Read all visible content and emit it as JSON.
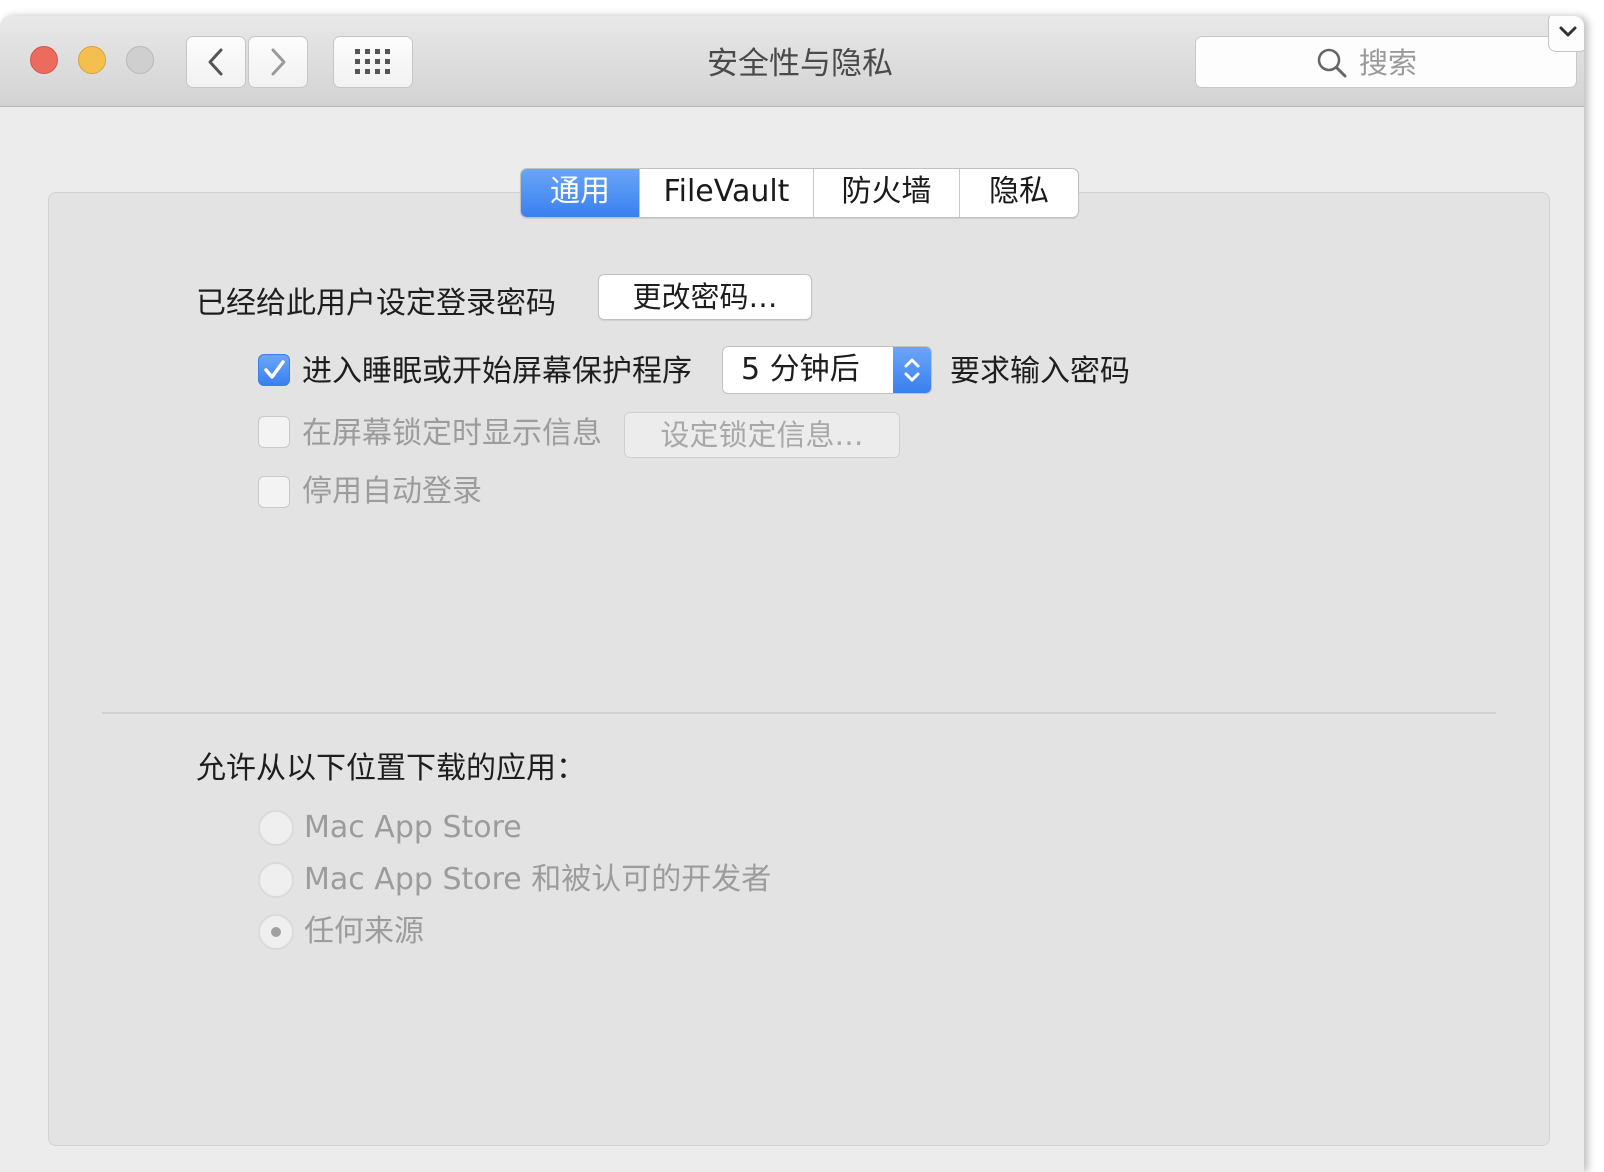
{
  "window": {
    "title": "安全性与隐私"
  },
  "toolbar": {
    "search_placeholder": "搜索"
  },
  "tabs": [
    {
      "label": "通用",
      "active": true
    },
    {
      "label": "FileVault",
      "active": false
    },
    {
      "label": "防火墙",
      "active": false
    },
    {
      "label": "隐私",
      "active": false
    }
  ],
  "general": {
    "password_label": "已经给此用户设定登录密码",
    "change_password_button": "更改密码…",
    "require_password_checkbox": {
      "checked": true,
      "label": "进入睡眠或开始屏幕保护程序"
    },
    "delay_select_value": "5 分钟后",
    "require_password_suffix": "要求输入密码",
    "show_message_checkbox": {
      "checked": false,
      "enabled": false,
      "label": "在屏幕锁定时显示信息"
    },
    "set_lock_message_button": "设定锁定信息…",
    "disable_autologin_checkbox": {
      "checked": false,
      "enabled": false,
      "label": "停用自动登录"
    }
  },
  "downloads": {
    "heading": "允许从以下位置下载的应用：",
    "options": [
      {
        "label": "Mac App Store",
        "selected": false
      },
      {
        "label": "Mac App Store 和被认可的开发者",
        "selected": false
      },
      {
        "label": "任何来源",
        "selected": true
      }
    ]
  },
  "colors": {
    "accent": "#3a7ff0",
    "close": "#ec6a5e",
    "minimize": "#f4bf4f"
  },
  "icons": [
    "back-chevron-icon",
    "forward-chevron-icon",
    "grid-icon",
    "search-icon",
    "chevron-down-icon",
    "checkmark-icon",
    "updown-arrows-icon"
  ]
}
